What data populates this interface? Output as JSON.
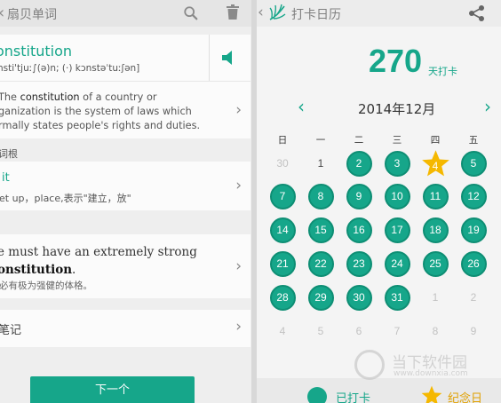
{
  "colors": {
    "accent": "#16a68a",
    "star": "#f5b800",
    "legend_text_gold": "#e0a000"
  },
  "left": {
    "header": {
      "title": "扇贝单词",
      "back_icon": "chevron-left-icon",
      "search_icon": "search-icon",
      "delete_icon": "trash-icon"
    },
    "word": {
      "text": "onstitution",
      "phonetic": "nsti'tjuː∫(ə)n; (·) kɔnstəˈtuːʃən]",
      "speaker_icon": "speaker-icon"
    },
    "definition": {
      "prefix": "The",
      "keyword": "constitution",
      "rest": "of a country or ganization is the system of laws which rmally states people's rights and duties."
    },
    "root_section": {
      "label": "词根"
    },
    "root": {
      "word": "it",
      "meaning": "et up，place,表示\"建立，放\""
    },
    "example_section": {
      "label": ""
    },
    "example": {
      "en_prefix": "e must have an extremely strong",
      "en_keyword": "onstitution",
      "en_suffix": ".",
      "cn": "必有极为强健的体格。"
    },
    "notes": {
      "label": "笔记"
    },
    "next_button": "下一个"
  },
  "right": {
    "header": {
      "title": "打卡日历",
      "share_icon": "share-icon"
    },
    "streak": {
      "count": "270",
      "label": "天打卡"
    },
    "month": {
      "label": "2014年12月"
    },
    "weekdays": [
      "日",
      "一",
      "二",
      "三",
      "四",
      "五"
    ],
    "calendar": [
      [
        {
          "d": "30",
          "s": "out"
        },
        {
          "d": "1",
          "s": "plain"
        },
        {
          "d": "2",
          "s": "done"
        },
        {
          "d": "3",
          "s": "done"
        },
        {
          "d": "4",
          "s": "star"
        },
        {
          "d": "5",
          "s": "done"
        }
      ],
      [
        {
          "d": "7",
          "s": "done"
        },
        {
          "d": "8",
          "s": "done"
        },
        {
          "d": "9",
          "s": "done"
        },
        {
          "d": "10",
          "s": "done"
        },
        {
          "d": "11",
          "s": "done"
        },
        {
          "d": "12",
          "s": "done"
        }
      ],
      [
        {
          "d": "14",
          "s": "done"
        },
        {
          "d": "15",
          "s": "done"
        },
        {
          "d": "16",
          "s": "done"
        },
        {
          "d": "17",
          "s": "done"
        },
        {
          "d": "18",
          "s": "done"
        },
        {
          "d": "19",
          "s": "done"
        }
      ],
      [
        {
          "d": "21",
          "s": "done"
        },
        {
          "d": "22",
          "s": "done"
        },
        {
          "d": "23",
          "s": "done"
        },
        {
          "d": "24",
          "s": "done"
        },
        {
          "d": "25",
          "s": "done"
        },
        {
          "d": "26",
          "s": "done"
        }
      ],
      [
        {
          "d": "28",
          "s": "done"
        },
        {
          "d": "29",
          "s": "done"
        },
        {
          "d": "30",
          "s": "done"
        },
        {
          "d": "31",
          "s": "done"
        },
        {
          "d": "1",
          "s": "out"
        },
        {
          "d": "2",
          "s": "out"
        }
      ],
      [
        {
          "d": "4",
          "s": "out"
        },
        {
          "d": "5",
          "s": "out"
        },
        {
          "d": "6",
          "s": "out"
        },
        {
          "d": "7",
          "s": "out"
        },
        {
          "d": "8",
          "s": "out"
        },
        {
          "d": "9",
          "s": "out"
        }
      ]
    ],
    "legend": {
      "done": "已打卡",
      "memorial": "纪念日"
    }
  },
  "watermark": {
    "cn": "当下软件园",
    "url": "www.downxia.com"
  }
}
